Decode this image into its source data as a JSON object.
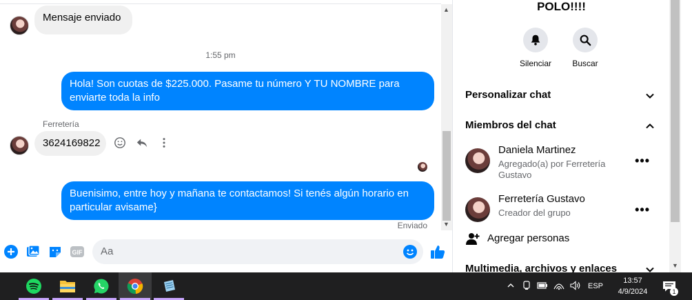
{
  "chat": {
    "prev_message": "Mensaje enviado",
    "time_separator": "1:55 pm",
    "out_message_1": "Hola! Son cuotas de $225.000. Pasame tu número Y TU NOMBRE para enviarte toda la info",
    "sender_name": "Ferretería",
    "in_message": "3624169822",
    "out_message_2": "Buenisimo, entre hoy y mañana te contactamos! Si tenés algún horario en particular avisame}",
    "status": "Enviado",
    "composer_placeholder": "Aa",
    "gif_label": "GIF"
  },
  "info": {
    "group_title": "POLO!!!!",
    "mute_label": "Silenciar",
    "search_label": "Buscar",
    "customize_label": "Personalizar chat",
    "members_label": "Miembros del chat",
    "members": [
      {
        "name": "Daniela Martinez",
        "sub": "Agregado(a) por Ferretería Gustavo"
      },
      {
        "name": "Ferretería Gustavo",
        "sub": "Creador del grupo"
      }
    ],
    "more_label": "•••",
    "add_people_label": "Agregar personas",
    "media_label": "Multimedia, archivos y enlaces"
  },
  "taskbar": {
    "language": "ESP",
    "time": "13:57",
    "date": "4/9/2024",
    "notification_count": "1",
    "apps": [
      "spotify-icon",
      "file-explorer-icon",
      "whatsapp-icon",
      "chrome-icon",
      "notepad-icon"
    ]
  },
  "colors": {
    "accent": "#0084ff",
    "bubble_in": "#f0f0f0",
    "taskbar": "#1f1f20"
  }
}
